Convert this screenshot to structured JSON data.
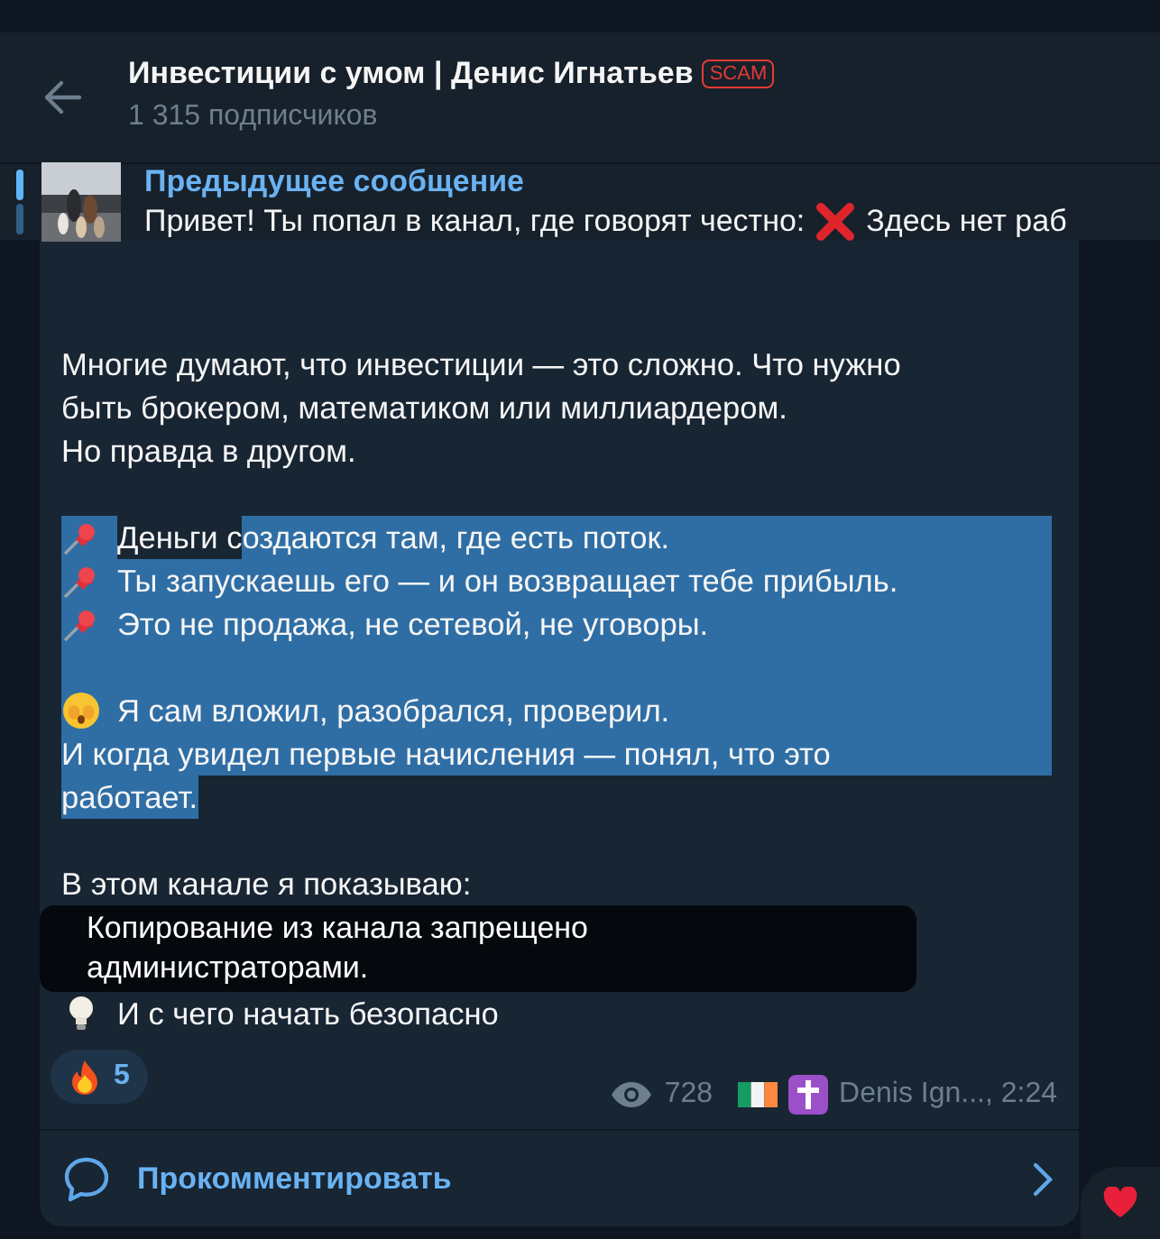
{
  "header": {
    "title": "Инвестиции с умом | Денис Игнатьев",
    "badge": "SCAM",
    "subtitle": "1 315 подписчиков"
  },
  "pinned": {
    "title": "Предыдущее сообщение",
    "text_before": "Привет! Ты попал в канал, где говорят честно:",
    "text_after": "Здесь нет раб"
  },
  "message": {
    "paragraphs": [
      {
        "lines": [
          {
            "text": "Многие думают, что инвестиции — это сложно. Что нужно",
            "selected": false
          },
          {
            "text": "быть брокером, математиком или миллиардером.",
            "selected": false
          },
          {
            "text": "Но правда в другом.",
            "selected": false
          }
        ]
      },
      {
        "lines": [
          {
            "kind": "pin",
            "before": "Деньги с",
            "text": "оздаются там, где есть поток.",
            "selected": true
          },
          {
            "kind": "pin",
            "text": "Ты запускаешь его — и он возвращает тебе прибыль.",
            "selected": true
          },
          {
            "kind": "pin",
            "text": "Это не продажа, не сетевой, не уговоры.",
            "selected": true
          }
        ]
      },
      {
        "lines": [
          {
            "kind": "face",
            "text": "Я сам вложил, разобрался, проверил.",
            "selected": true
          },
          {
            "text": "И когда увидел первые начисления — понял, что это",
            "selected": true
          },
          {
            "text": "работает.",
            "selected": true
          }
        ]
      },
      {
        "lines": [
          {
            "text": "В этом канале я показываю:",
            "selected": false
          },
          {
            "kind": "bulb",
            "text": "И с чего начать безопасно",
            "selected": false
          }
        ]
      }
    ],
    "reaction": {
      "count": "5"
    },
    "views": "728",
    "signature": "Denis Ign..., 2:24",
    "comment": "Прокомментировать"
  },
  "toast": {
    "text": "Копирование из канала запрещено администраторами."
  }
}
